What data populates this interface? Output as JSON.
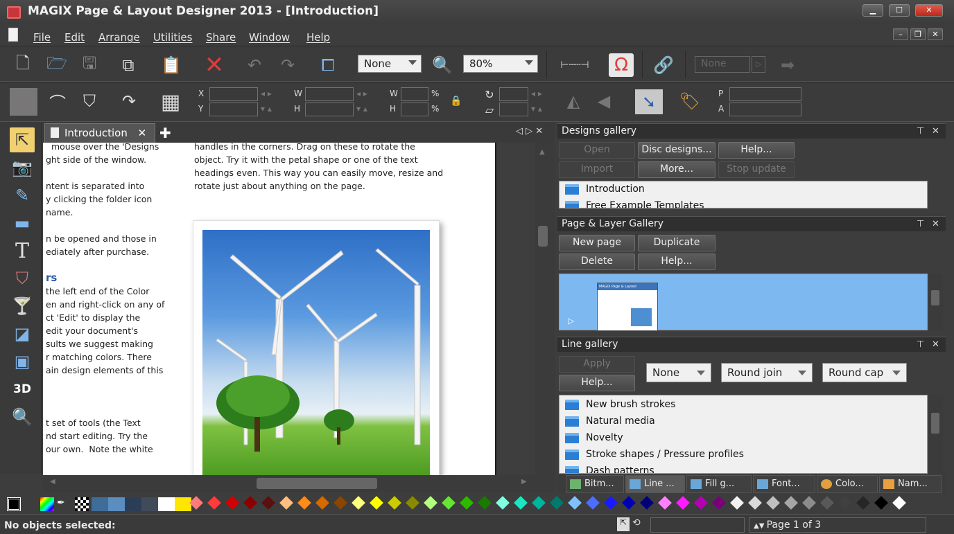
{
  "window": {
    "title": "MAGIX Page & Layout Designer 2013 - [Introduction]"
  },
  "menu": [
    "File",
    "Edit",
    "Arrange",
    "Utilities",
    "Share",
    "Window",
    "Help"
  ],
  "toolbar": {
    "fill_combo": "None",
    "zoom": "80%",
    "link_combo": "None"
  },
  "infobar": {
    "x": "X",
    "y": "Y",
    "w1": "W",
    "h1": "H",
    "w2": "W",
    "h2": "H",
    "pct1": "%",
    "pct2": "%",
    "p": "P",
    "a": "A"
  },
  "doc": {
    "tab_label": "Introduction",
    "left_col": [
      "  mouse over the 'Designs",
      "ght side of the window.",
      "",
      "ntent is separated into",
      "y clicking the folder icon",
      "name.",
      "",
      "n be opened and those in",
      "ediately after purchase.",
      "",
      "rs",
      "the left end of the Color",
      "en and right-click on any of",
      "ct 'Edit' to display the",
      "edit your document's",
      "sults we suggest making",
      "r matching colors. There",
      "ain design elements of this",
      "",
      "",
      "",
      "t set of tools (the Text",
      "nd start editing. Try the",
      "our own.  Note the white"
    ],
    "right_col": [
      "handles in the corners. Drag on these to rotate the",
      "object. Try it with the petal shape or one of the text",
      "headings even. This way you can easily move, resize and",
      "rotate just about anything on the page."
    ]
  },
  "designs_gallery": {
    "title": "Designs gallery",
    "buttons": {
      "open": "Open",
      "disc": "Disc designs...",
      "help": "Help...",
      "import": "Import",
      "more": "More...",
      "stop": "Stop update"
    },
    "items": [
      "Introduction",
      "Free Example Templates"
    ]
  },
  "page_gallery": {
    "title": "Page & Layer Gallery",
    "buttons": {
      "new": "New page",
      "dup": "Duplicate",
      "del": "Delete",
      "help": "Help..."
    },
    "thumb_title": "MAGIX Page & Layout"
  },
  "line_gallery": {
    "title": "Line gallery",
    "buttons": {
      "apply": "Apply",
      "help": "Help..."
    },
    "combos": {
      "arrow": "None",
      "join": "Round join",
      "cap": "Round cap"
    },
    "items": [
      "New brush strokes",
      "Natural media",
      "Novelty",
      "Stroke shapes / Pressure profiles",
      "Dash patterns"
    ]
  },
  "gallery_tabs": [
    "Bitm...",
    "Line ...",
    "Fill g...",
    "Font...",
    "Colo...",
    "Nam..."
  ],
  "status": {
    "text": "No objects selected:",
    "page": "Page 1 of 3"
  },
  "palette_colors": [
    "#3f6d9a",
    "#5a8dc0",
    "#2c3e56",
    "#404b5a",
    "#ffffff",
    "#ffe600",
    "#ff7a7a",
    "#ff3b3b",
    "#d40000",
    "#8a0000",
    "#5a1010",
    "#ffbf80",
    "#ff8c1a",
    "#d46a00",
    "#8a4500",
    "#ffff80",
    "#ffff00",
    "#cccc00",
    "#8a8a00",
    "#b3ff80",
    "#66e633",
    "#2fb800",
    "#1a7a00",
    "#80ffe0",
    "#1ae6c0",
    "#00b39a",
    "#007a6a",
    "#80c0ff",
    "#4d6dff",
    "#1a1aff",
    "#0000b3",
    "#00007a",
    "#ff80ff",
    "#ff1aff",
    "#b300b3",
    "#7a007a",
    "#f2f2f2",
    "#d9d9d9",
    "#bfbfbf",
    "#a6a6a6",
    "#8c8c8c",
    "#595959",
    "#404040",
    "#262626",
    "#000000",
    "#ffffff"
  ]
}
